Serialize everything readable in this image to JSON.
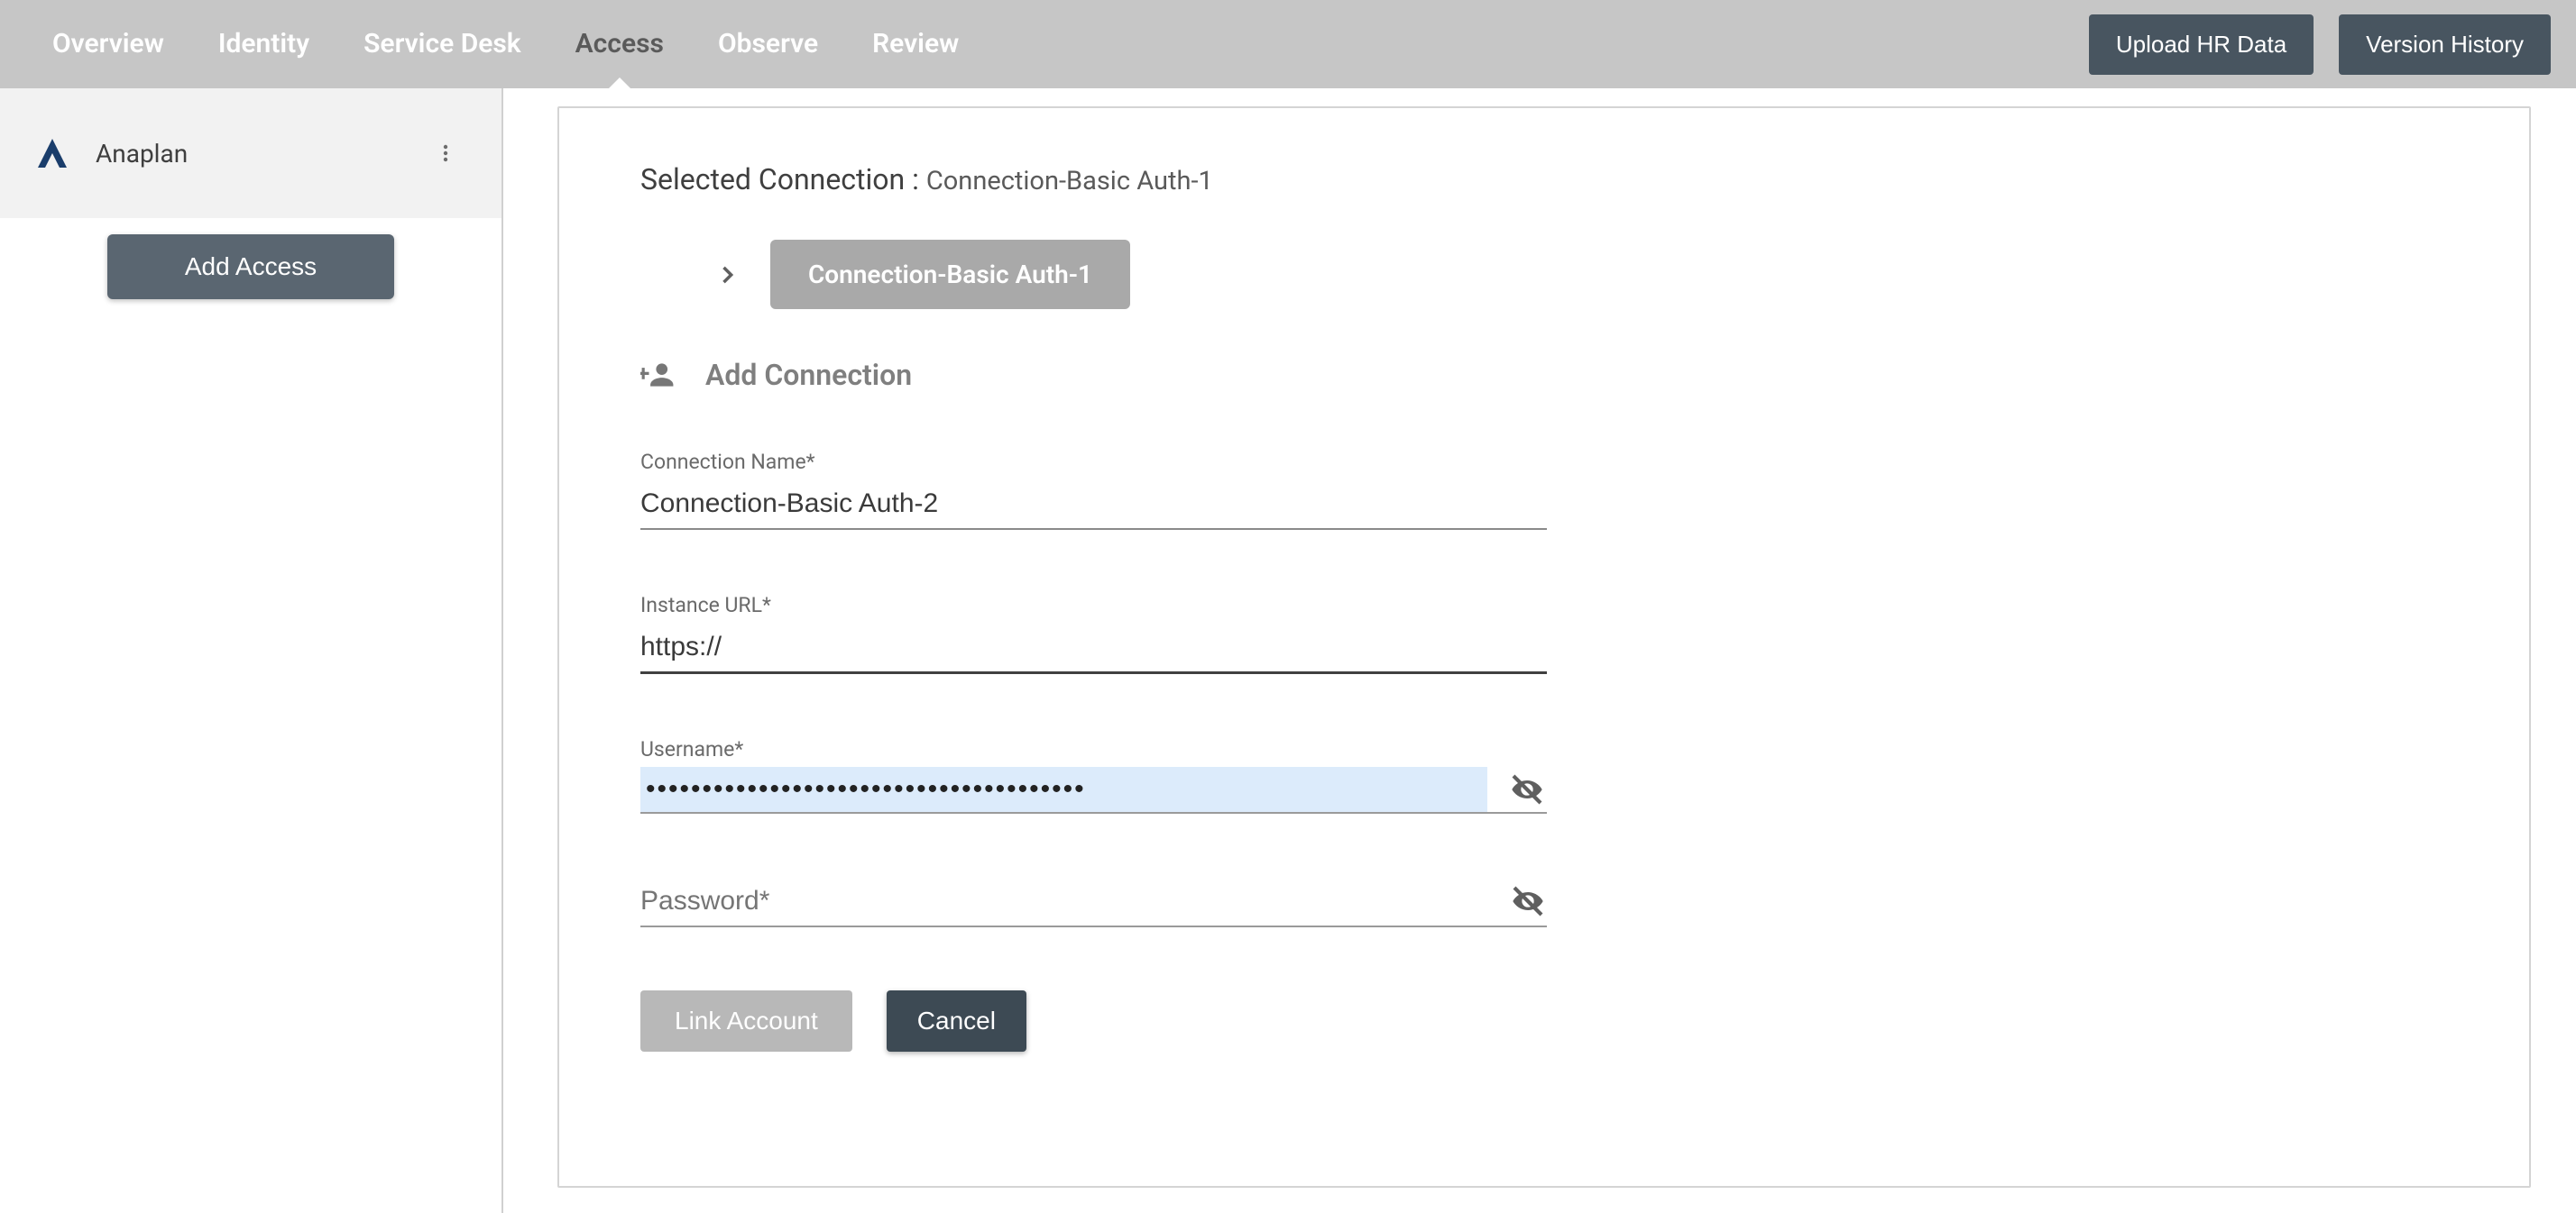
{
  "topbar": {
    "tabs": [
      {
        "label": "Overview",
        "active": false
      },
      {
        "label": "Identity",
        "active": false
      },
      {
        "label": "Service Desk",
        "active": false
      },
      {
        "label": "Access",
        "active": true
      },
      {
        "label": "Observe",
        "active": false
      },
      {
        "label": "Review",
        "active": false
      }
    ],
    "uploadBtn": "Upload HR Data",
    "versionBtn": "Version History"
  },
  "sidebar": {
    "app": {
      "name": "Anaplan"
    },
    "addAccessBtn": "Add Access"
  },
  "panel": {
    "selectedConnectionLabel": "Selected Connection :",
    "selectedConnectionValue": "Connection-Basic Auth-1",
    "connectionPill": "Connection-Basic Auth-1",
    "addConnectionLabel": "Add Connection",
    "fields": {
      "connectionName": {
        "label": "Connection Name*",
        "value": "Connection-Basic Auth-2"
      },
      "instanceUrl": {
        "label": "Instance URL*",
        "value": "https://"
      },
      "username": {
        "label": "Username*",
        "value": "•••••••••••••••••••••••••••••••••••••••"
      },
      "password": {
        "label": "Password*",
        "value": ""
      }
    },
    "linkBtn": "Link Account",
    "cancelBtn": "Cancel"
  }
}
